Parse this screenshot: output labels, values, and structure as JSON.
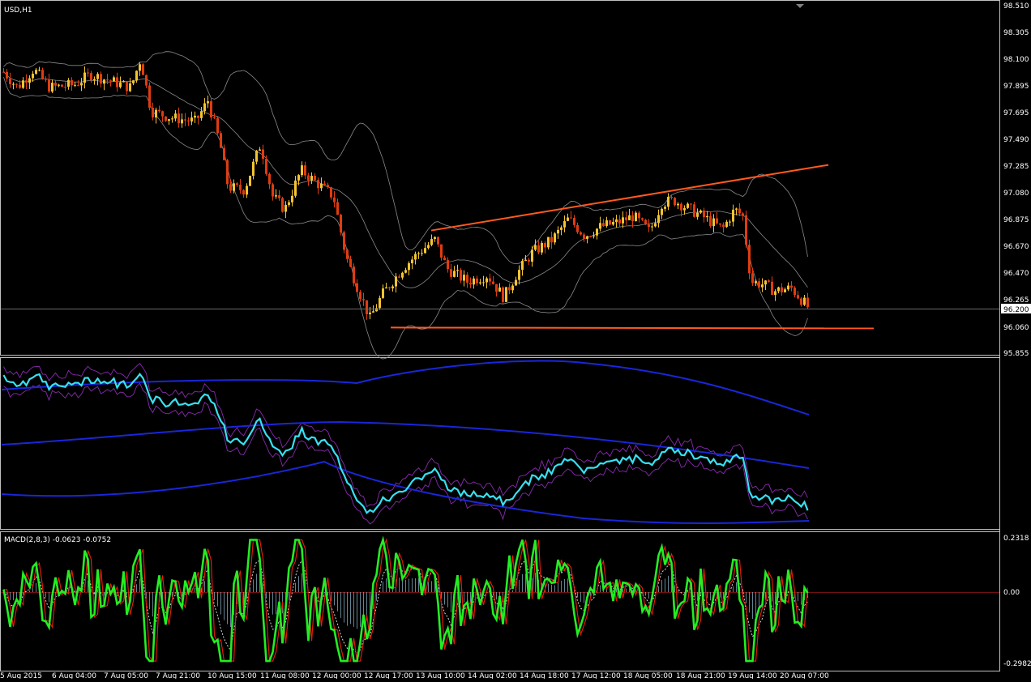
{
  "colors": {
    "background": "#000000",
    "frame": "#c0c0c0",
    "text": "#ffffff",
    "candle_up": "#f4c430",
    "candle_down": "#e03c10",
    "bollinger": "#8a8a8a",
    "trendline": "#ff5a1e",
    "rsi_line": "#38e0f0",
    "rsi_envelope": "#8a2ab0",
    "rsi_band": "#1a26d8",
    "macd_main": "#22ee22",
    "macd_signal": "#d8d8d8",
    "macd_fast": "#e01a10",
    "macd_hist": "#7ea6b8",
    "zero_line": "#701010"
  },
  "main_chart": {
    "label": "USD,H1",
    "price_axis": [
      "98.510",
      "98.305",
      "98.100",
      "97.895",
      "97.695",
      "97.490",
      "97.285",
      "97.080",
      "96.875",
      "96.670",
      "96.470",
      "96.265",
      "96.060",
      "95.855"
    ],
    "current_price": "96.200",
    "resistance_line": {
      "from_price": 96.79,
      "to_price": 97.29
    },
    "support_line": {
      "price": 96.05
    }
  },
  "macd_panel": {
    "label": "MACD(2,8,3) -0.0623 -0.0752",
    "axis": [
      "0.2318",
      "0.00",
      "-0.2982"
    ]
  },
  "time_axis": [
    "5 Aug 2015",
    "6 Aug 04:00",
    "7 Aug 05:00",
    "7 Aug 21:00",
    "10 Aug 15:00",
    "11 Aug 08:00",
    "12 Aug 00:00",
    "12 Aug 17:00",
    "13 Aug 10:00",
    "14 Aug 02:00",
    "14 Aug 18:00",
    "17 Aug 12:00",
    "18 Aug 05:00",
    "18 Aug 21:00",
    "19 Aug 14:00",
    "20 Aug 07:00"
  ]
}
